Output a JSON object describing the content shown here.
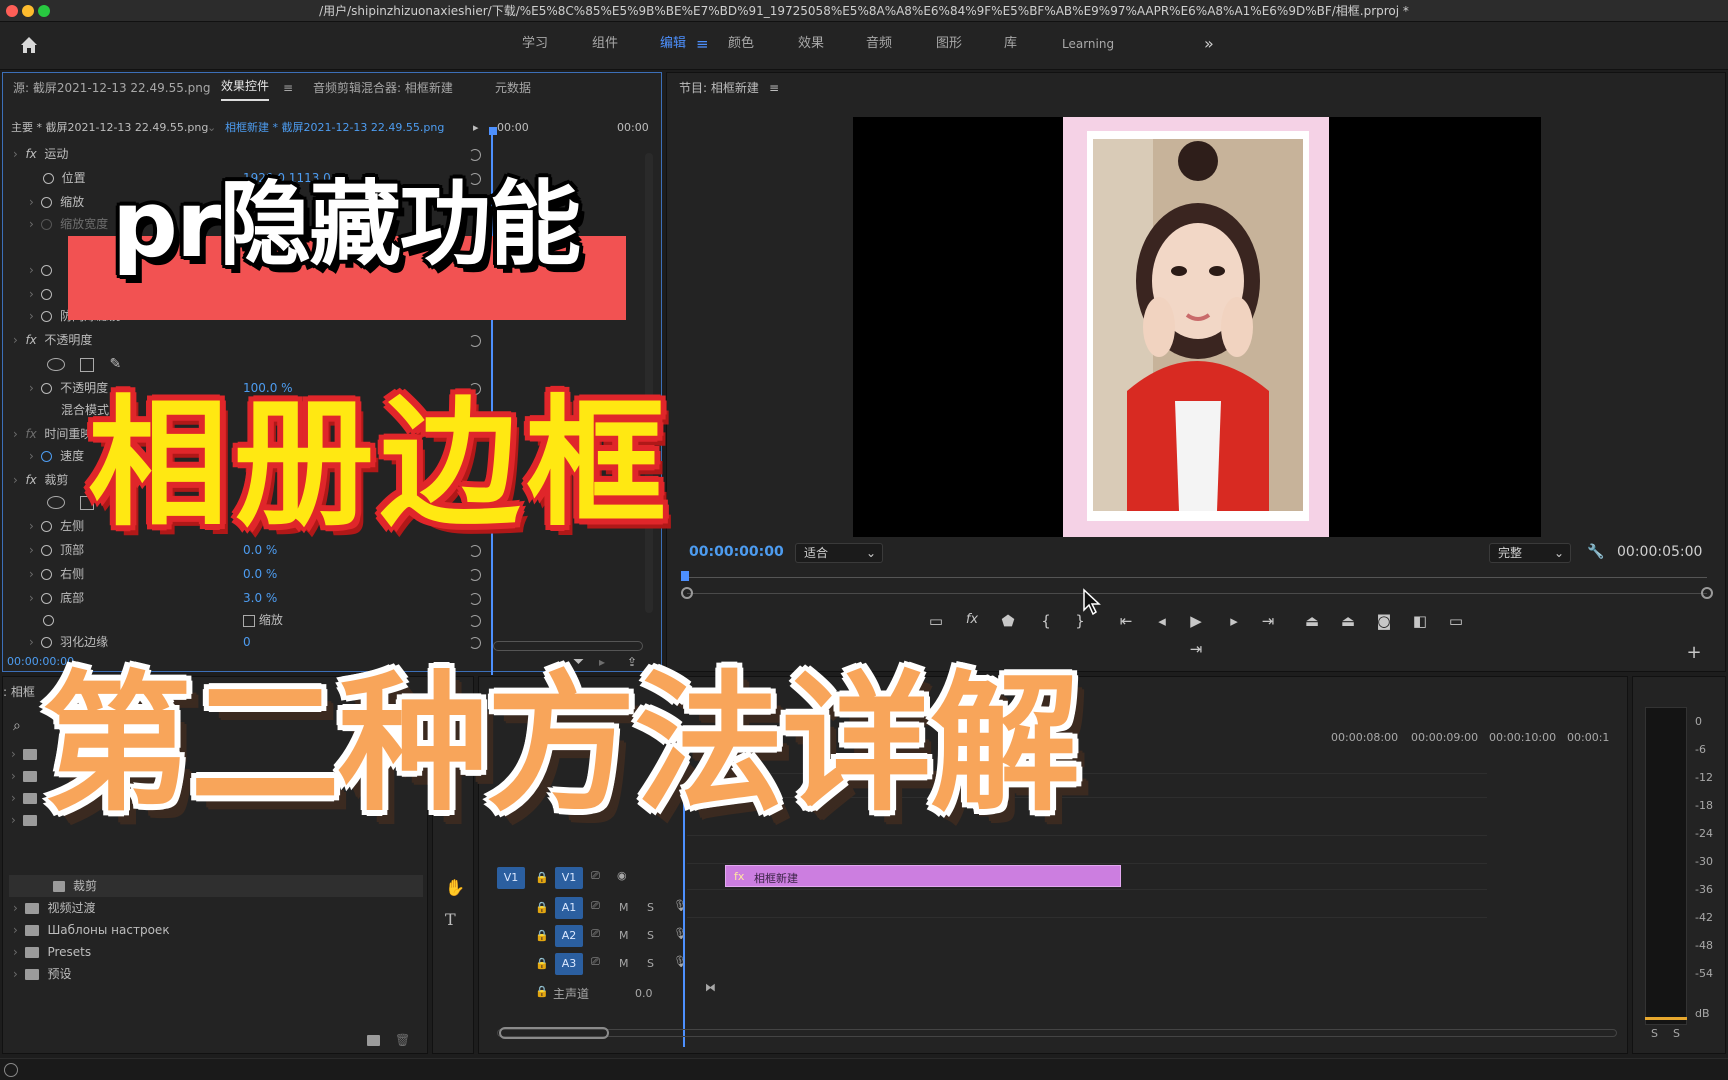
{
  "titlebar": {
    "path": "/用户/shipinzhizuonaxieshier/下载/%E5%8C%85%E5%9B%BE%E7%BD%91_19725058%E5%8A%A8%E6%84%9F%E5%BF%AB%E9%97%AAPR%E6%A8%A1%E6%9D%BF/相框.prproj *"
  },
  "workspace": {
    "tabs": [
      "学习",
      "组件",
      "编辑",
      "颜色",
      "效果",
      "音频",
      "图形",
      "库",
      "Learning"
    ],
    "active": "编辑",
    "more": "»"
  },
  "source_panel": {
    "tabs": [
      "源: 截屏2021-12-13 22.49.55.png",
      "效果控件",
      "音频剪辑混合器: 相框新建",
      "元数据"
    ],
    "master_label": "主要 * 截屏2021-12-13 22.49.55.png",
    "clip_label": "相框新建 * 截屏2021-12-13 22.49.55.png",
    "ruler_start": "00:00",
    "ruler_end": "00:00",
    "rows": [
      {
        "label": "运动"
      },
      {
        "label": "位置",
        "value": "1920.0    1113.0"
      },
      {
        "label": "缩放"
      },
      {
        "label": "缩放宽度"
      },
      {
        "label": "防闪烁滤镜",
        "value": "0.00"
      },
      {
        "label": "不透明度"
      },
      {
        "label": "不透明度",
        "value": "100.0 %"
      },
      {
        "label": "混合模式",
        "value": "正"
      },
      {
        "label": "时间重映射"
      },
      {
        "label": "速度"
      },
      {
        "label": "裁剪"
      },
      {
        "label": "左侧",
        "value": "0.0"
      },
      {
        "label": "顶部",
        "value": "0.0 %"
      },
      {
        "label": "右侧",
        "value": "0.0 %"
      },
      {
        "label": "底部",
        "value": "3.0 %"
      },
      {
        "label": "缩放"
      },
      {
        "label": "羽化边缘",
        "value": "0"
      }
    ],
    "timecode": "00:00:00:00"
  },
  "program_panel": {
    "title": "节目: 相框新建",
    "timecode": "00:00:00:00",
    "fit_option": "适合",
    "quality_option": "完整",
    "duration": "00:00:05:00"
  },
  "project_panel": {
    "title": ": 相框",
    "items": [
      "裁剪",
      "视频过渡",
      "Шаблоны настроек",
      "Presets",
      "预设"
    ]
  },
  "timeline": {
    "ruler": [
      "00:00:08:00",
      "00:00:09:00",
      "00:00:10:00",
      "00:00:1"
    ],
    "tracks": [
      "V1",
      "A1",
      "A2",
      "A3"
    ],
    "track_source": "V1",
    "master_label": "主声道",
    "master_value": "0.0",
    "clip_label": "相框新建",
    "mute": "M",
    "solo": "S"
  },
  "audio_meter": {
    "scale": [
      "0",
      "-6",
      "-12",
      "-18",
      "-24",
      "-30",
      "-36",
      "-42",
      "-48",
      "-54",
      "dB"
    ],
    "solo": "S"
  },
  "overlay": {
    "title": "pr隐藏功能",
    "subtitle": "相册边框",
    "headline": "第二种方法详解"
  },
  "colors": {
    "accent": "#4d90fe",
    "pill": "#f25252",
    "yellow": "#ffe812",
    "orange": "#f8a55a",
    "clip": "#cc7ee0"
  }
}
